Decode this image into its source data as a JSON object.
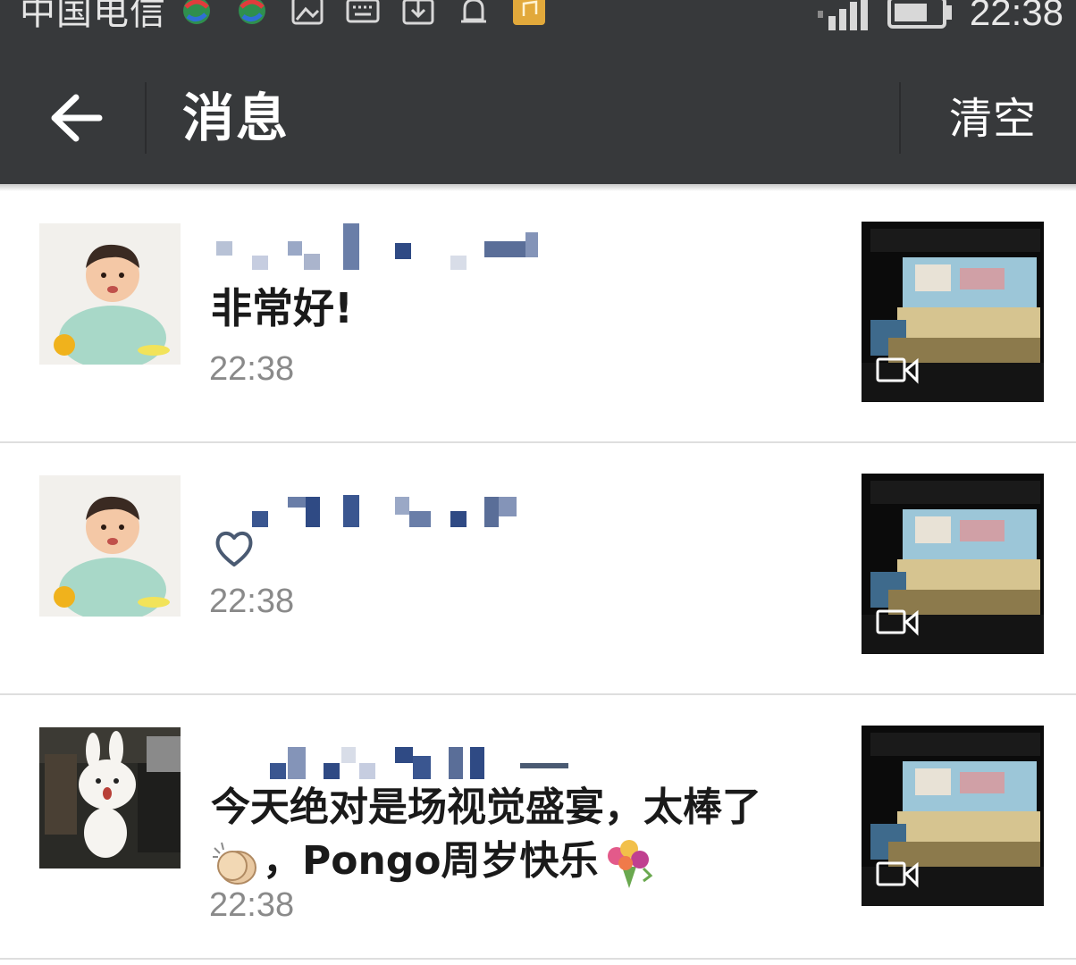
{
  "status_bar": {
    "carrier": "中国电信",
    "clock": "22:38",
    "icons": [
      "network-operator-icon",
      "network-operator-icon",
      "image-icon",
      "keyboard-icon",
      "download-icon",
      "bell-icon",
      "music-app-icon",
      "signal-icon",
      "battery-icon"
    ]
  },
  "header": {
    "title": "消息",
    "clear_label": "清空"
  },
  "messages": [
    {
      "text": "非常好!",
      "time": "22:38",
      "avatar": "baby-photo",
      "has_video": true
    },
    {
      "text": "",
      "icon": "heart-icon",
      "time": "22:38",
      "avatar": "baby-photo",
      "has_video": true
    },
    {
      "text_line1": "今天绝对是场视觉盛宴，太棒了",
      "text_line2": "，Pongo周岁快乐",
      "time": "22:38",
      "avatar": "cartoon-bunny-photo",
      "has_video": true
    }
  ],
  "colors": {
    "header_bg": "#37393b",
    "time_text": "#8a8a8a",
    "divider": "#dedede"
  }
}
